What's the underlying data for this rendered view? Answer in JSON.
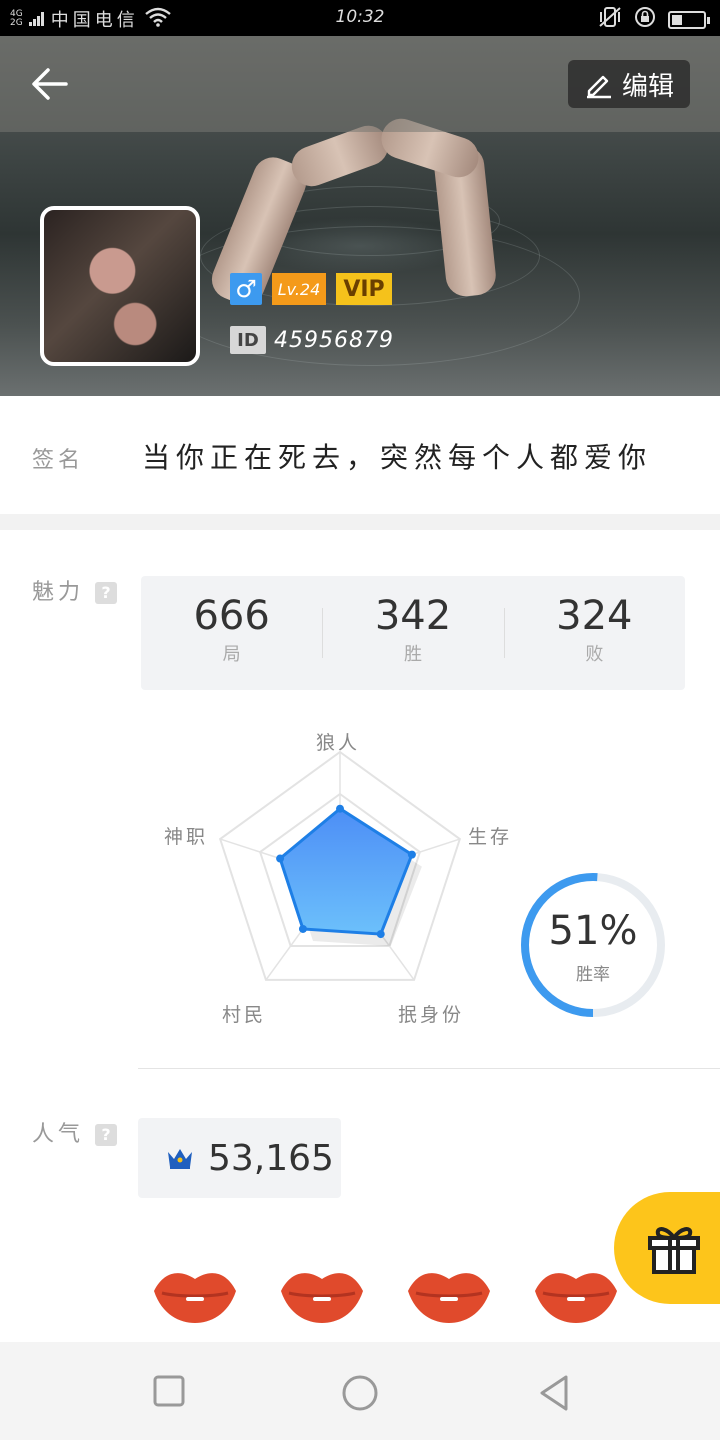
{
  "status_bar": {
    "network": "4G\n2G",
    "carrier": "中国电信",
    "time": "10:32"
  },
  "header": {
    "edit_label": "编辑"
  },
  "profile": {
    "level": "Lv.24",
    "vip": "VIP",
    "id_tag": "ID",
    "id_value": "45956879",
    "gender": "♂"
  },
  "signature": {
    "label": "签名",
    "text": "当你正在死去，突然每个人都爱你"
  },
  "ability": {
    "label": "魅力",
    "stats": [
      {
        "value": "666",
        "caption": "局"
      },
      {
        "value": "342",
        "caption": "胜"
      },
      {
        "value": "324",
        "caption": "败"
      }
    ]
  },
  "radar": {
    "axes": [
      "狼人",
      "生存",
      "抿身份",
      "村民",
      "神职"
    ],
    "values": [
      0.55,
      0.6,
      0.55,
      0.5,
      0.5
    ]
  },
  "win_rate": {
    "value": "51%",
    "caption": "胜率",
    "fraction": 0.51
  },
  "popularity": {
    "label": "人气",
    "value": "53,165"
  },
  "colors": {
    "accent": "#3d9aef",
    "radar_fill": "#4aa3f5",
    "gift": "#fdc51b",
    "lips": "#e04a2c"
  }
}
